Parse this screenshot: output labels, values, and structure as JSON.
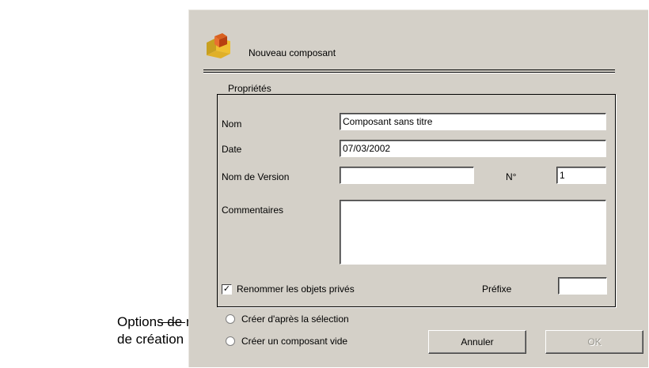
{
  "annotation": {
    "line1": "Options de mode",
    "line2": "de création"
  },
  "dialog": {
    "title": "Nouveau composant",
    "group_label": "Propriétés",
    "fields": {
      "nom": {
        "label": "Nom",
        "value": "Composant sans titre"
      },
      "date": {
        "label": "Date",
        "value": "07/03/2002"
      },
      "version": {
        "label": "Nom de Version",
        "value": ""
      },
      "numero": {
        "label": "N°",
        "value": "1"
      },
      "commentaires": {
        "label": "Commentaires",
        "value": ""
      },
      "prefixe": {
        "label": "Préfixe",
        "value": ""
      }
    },
    "checkbox": {
      "label": "Renommer les objets privés",
      "checked": true
    },
    "radios": [
      {
        "label": "Créer d'après la sélection"
      },
      {
        "label": "Créer un composant vide"
      }
    ],
    "buttons": {
      "cancel": "Annuler",
      "ok": "OK"
    }
  }
}
